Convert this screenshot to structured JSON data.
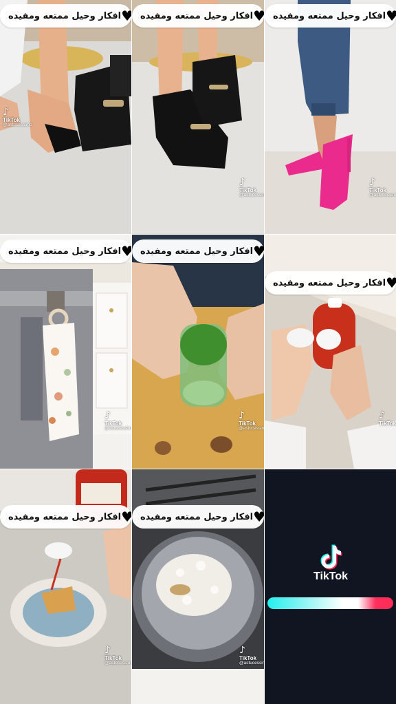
{
  "caption": {
    "text": "افكار وحيل ممتعه ومفيده",
    "heart_icon": "heart-icon"
  },
  "watermark": {
    "brand": "TikTok",
    "user": "@astucessimo"
  },
  "endcard": {
    "brand": "TikTok",
    "logo_icon": "tiktok-logo-icon",
    "bg_color": "#111521"
  },
  "accent_colors": {
    "cyan": "#24f0ec",
    "red": "#fe2c55"
  },
  "tiles": [
    {
      "id": "tile-1",
      "scene": "foot-in-sock-liner-with-loafers",
      "has_caption": true,
      "has_watermark": true
    },
    {
      "id": "tile-2",
      "scene": "feet-in-black-loafers",
      "has_caption": true,
      "has_watermark": true
    },
    {
      "id": "tile-3",
      "scene": "pink-heels-and-jeans",
      "has_caption": true,
      "has_watermark": true
    },
    {
      "id": "tile-4",
      "scene": "towel-hanging-on-drawer",
      "has_caption": true,
      "has_watermark": true
    },
    {
      "id": "tile-5",
      "scene": "hands-holding-jar-of-herbs",
      "has_caption": true,
      "has_watermark": true
    },
    {
      "id": "tile-6",
      "scene": "hands-opening-ketchup-cap",
      "has_caption": true,
      "has_watermark": true
    },
    {
      "id": "tile-7",
      "scene": "ketchup-on-plate",
      "has_caption": true,
      "has_watermark": true
    },
    {
      "id": "tile-8",
      "scene": "popcorn-in-strainer",
      "has_caption": true,
      "has_watermark": true
    },
    {
      "id": "tile-9",
      "scene": "tiktok-end-card",
      "has_caption": false,
      "has_watermark": false
    }
  ]
}
